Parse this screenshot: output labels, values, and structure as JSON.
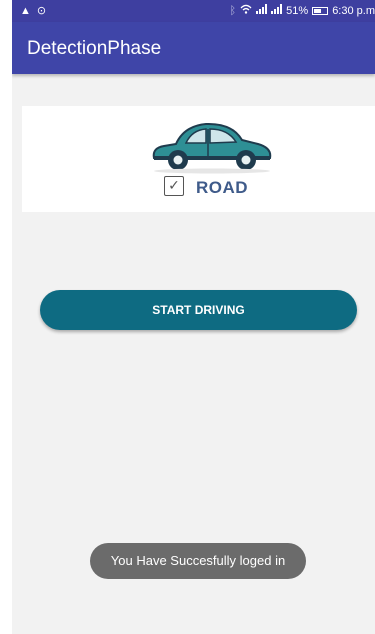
{
  "status_bar": {
    "time": "6:30 p.m",
    "battery": "51%",
    "left_icons": [
      "warning-icon",
      "timer-icon"
    ],
    "right_icons": [
      "bluetooth-icon",
      "wifi-icon",
      "signal-icon",
      "signal-icon",
      "battery-icon"
    ]
  },
  "app_bar": {
    "title": "DetectionPhase"
  },
  "card": {
    "checkbox_symbol": "✓",
    "checked": true,
    "label": "ROAD",
    "image_icon": "car-icon"
  },
  "main": {
    "start_button_label": "START DRIVING"
  },
  "toast": {
    "message": "You Have Succesfully loged in"
  },
  "colors": {
    "app_bar": "#3f45a8",
    "button": "#0e6b82",
    "road_label": "#3f5b8a",
    "toast": "#6b6b6b",
    "background": "#f2f2f2"
  }
}
